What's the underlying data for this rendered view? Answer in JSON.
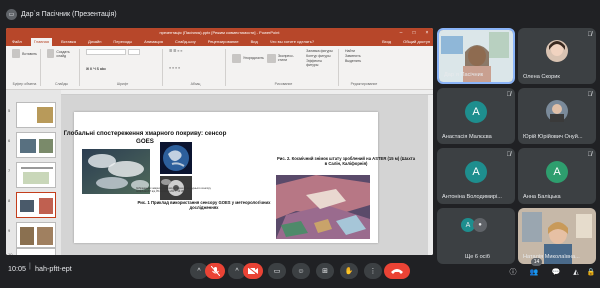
{
  "presenter": {
    "label": "Дар`я Пасічник (Презентація)"
  },
  "ppt": {
    "window_title": "презентація (Пасічник).pptx [Режим совместимости] - PowerPoint",
    "tabs": [
      "Файл",
      "Главная",
      "Вставка",
      "Дизайн",
      "Переходы",
      "Анимация",
      "Слайд-шоу",
      "Рецензирование",
      "Вид",
      "Что вы хотите сделать?"
    ],
    "account": "Вход",
    "share": "Общий доступ",
    "ribbon": {
      "clipboard": "Буфер обмена",
      "paste": "Вставить",
      "create_slide": "Создать слайд",
      "slides": "Слайды",
      "font": "Шрифт",
      "paragraph": "Абзац",
      "drawing": "Рисование",
      "editing": "Редактирование",
      "arrange": "Упорядочить",
      "quick_styles": "Экспресс-стили",
      "shape_fill": "Заливка фигуры",
      "shape_outline": "Контур фигуры",
      "shape_effects": "Эффекты фигуры",
      "find": "Найти",
      "replace": "Заменить",
      "select": "Выделить"
    },
    "slide_numbers": [
      "5",
      "6",
      "7",
      "8",
      "9",
      "10"
    ],
    "slide": {
      "title": "Глобальні спостереження хмарного покриву: сенсор GOES",
      "caption1": "Рис. 1 Приклад використання сенсору GOES у метеорологічних дослідженнях",
      "caption2": "Рис. 2. Космічний знімок штату зроблений на ASTER (15 м) (Шахта в Салін, Каліфорнія)",
      "small_caption": "Зображення хмарного покриву з Першого середнього сенсору GOES-EAST від 05 вересня 2017, 13:30"
    }
  },
  "participants": [
    {
      "name": "Дар`я Пасічник",
      "type": "video"
    },
    {
      "name": "Олена Скорик",
      "type": "photo"
    },
    {
      "name": "Анастасія Малєєва",
      "type": "avatar",
      "initial": "А",
      "color": "#1e8e8e"
    },
    {
      "name": "Юрій Юрійович Онуй...",
      "type": "photo"
    },
    {
      "name": "Антоніна Володимирі...",
      "type": "avatar",
      "initial": "А",
      "color": "#1e8e8e"
    },
    {
      "name": "Анна Баліцька",
      "type": "avatar",
      "initial": "А",
      "color": "#2e9e6e"
    },
    {
      "name": "Ще 6 осіб",
      "type": "more"
    },
    {
      "name": "Наталія Миколаївна...",
      "type": "video"
    }
  ],
  "bottom": {
    "time": "10:05",
    "code": "hah-pftt-ept",
    "participants_count": "14"
  },
  "colors": {
    "ppt_accent": "#b7472a",
    "end_call": "#ea4335",
    "mic_off": "#ea4335"
  }
}
